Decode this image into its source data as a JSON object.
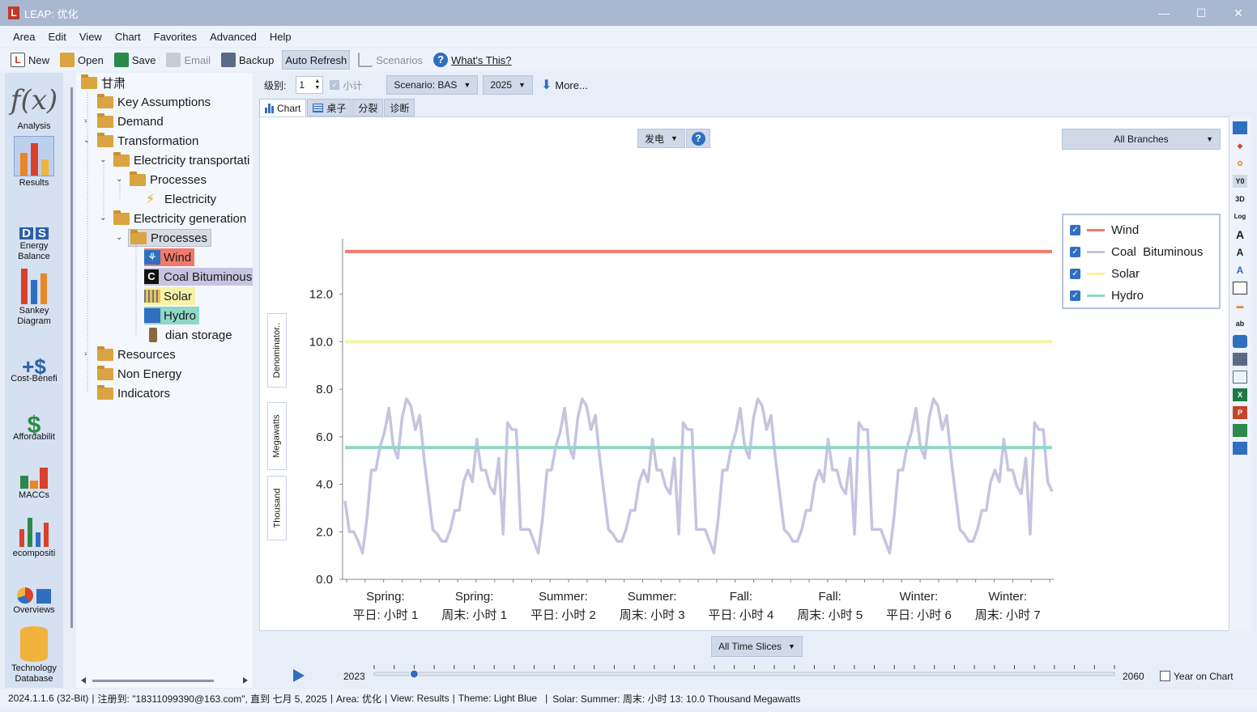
{
  "window": {
    "title": "LEAP: 优化",
    "minimize": "—",
    "maximize": "☐",
    "close": "✕"
  },
  "menu": [
    "Area",
    "Edit",
    "View",
    "Chart",
    "Favorites",
    "Advanced",
    "Help"
  ],
  "toolbar": {
    "new": "New",
    "open": "Open",
    "save": "Save",
    "email": "Email",
    "backup": "Backup",
    "auto_refresh": "Auto Refresh",
    "scenarios": "Scenarios",
    "whats_this": "What's This?"
  },
  "views": [
    {
      "label": "Analysis"
    },
    {
      "label": "Results"
    },
    {
      "label": "Energy Balance"
    },
    {
      "label": "Sankey Diagram"
    },
    {
      "label": "Cost-Benefi"
    },
    {
      "label": "Affordabilit"
    },
    {
      "label": "MACCs"
    },
    {
      "label": "ecompositi"
    },
    {
      "label": "Overviews"
    },
    {
      "label": "Technology Database"
    }
  ],
  "tree": {
    "root": "甘肃",
    "key_assumptions": "Key Assumptions",
    "demand": "Demand",
    "transformation": "Transformation",
    "elec_transport": "Electricity transportati",
    "processes1": "Processes",
    "electricity": "Electricity",
    "elec_generation": "Electricity generation",
    "processes2": "Processes",
    "wind": "Wind",
    "coal": "Coal Bituminous",
    "solar": "Solar",
    "hydro": "Hydro",
    "storage": "dian storage",
    "resources": "Resources",
    "non_energy": "Non Energy",
    "indicators": "Indicators"
  },
  "controls": {
    "level_label": "级别:",
    "level_value": "1",
    "subtotal": "小计",
    "scenario": "Scenario: BAS",
    "year": "2025",
    "more": "More...",
    "fuel": "发电",
    "help": "?",
    "branches": "All Branches",
    "time_slices": "All Time Slices"
  },
  "tabs": [
    "Chart",
    "桌子",
    "分裂",
    "诊断"
  ],
  "units": {
    "denominator": "Denominator..",
    "megawatts": "Megawatts",
    "thousand": "Thousand"
  },
  "timeline": {
    "start": "2023",
    "end": "2060",
    "year_on_chart": "Year on Chart",
    "current_position": 0.054
  },
  "status": {
    "version": "2024.1.1.6 (32-Bit)",
    "registered": "注册到: \"18311099390@163.com\", 直到 七月 5, 2025",
    "area": "Area: 优化",
    "view": "View: Results",
    "theme": "Theme: Light Blue",
    "hover": "Solar: Summer: 周末: 小时 13: 10.0 Thousand Megawatts"
  },
  "colors": {
    "wind": "#f07a6b",
    "coal": "#c7c3e0",
    "solar": "#f7f3a6",
    "hydro": "#8fd8c7",
    "accent": "#2f6fc0"
  },
  "chart_data": {
    "type": "line",
    "ylim": [
      0,
      14
    ],
    "yticks": [
      "0.0",
      "2.0",
      "4.0",
      "6.0",
      "8.0",
      "10.0",
      "12.0"
    ],
    "x_groups": [
      {
        "top": "Spring:",
        "bottom": "平日: 小时 1"
      },
      {
        "top": "Spring:",
        "bottom": "周末: 小时 1"
      },
      {
        "top": "Summer:",
        "bottom": "平日: 小时 2"
      },
      {
        "top": "Summer:",
        "bottom": "周末: 小时 3"
      },
      {
        "top": "Fall:",
        "bottom": "平日: 小时 4"
      },
      {
        "top": "Fall:",
        "bottom": "周末: 小时 5"
      },
      {
        "top": "Winter:",
        "bottom": "平日: 小时 6"
      },
      {
        "top": "Winter:",
        "bottom": "周末: 小时 7"
      }
    ],
    "series": [
      {
        "name": "Wind",
        "constant": 13.8
      },
      {
        "name": "Coal  Bituminous",
        "values": [
          3.3,
          2.0,
          2.0,
          1.6,
          1.1,
          2.6,
          4.6,
          4.6,
          5.6,
          6.2,
          7.2,
          5.6,
          5.1,
          6.8,
          7.6,
          7.3,
          6.3,
          6.9,
          5.1,
          3.6,
          2.1,
          1.9,
          1.6,
          1.6,
          2.1,
          2.9,
          2.9,
          4.1,
          4.6,
          4.1,
          5.9,
          4.6,
          4.6,
          3.9,
          3.6,
          5.1,
          1.9,
          6.6,
          6.3,
          6.3,
          2.1,
          2.1,
          2.1,
          1.6,
          1.1,
          2.6,
          4.6,
          4.6,
          5.6,
          6.2,
          7.2,
          5.6,
          5.1,
          6.8,
          7.6,
          7.3,
          6.3,
          6.9,
          5.1,
          3.6,
          2.1,
          1.9,
          1.6,
          1.6,
          2.1,
          2.9,
          2.9,
          4.1,
          4.6,
          4.1,
          5.9,
          4.6,
          4.6,
          3.9,
          3.6,
          5.1,
          1.9,
          6.6,
          6.3,
          6.3,
          2.1,
          2.1,
          2.1,
          1.6,
          1.1,
          2.6,
          4.6,
          4.6,
          5.6,
          6.2,
          7.2,
          5.6,
          5.1,
          6.8,
          7.6,
          7.3,
          6.3,
          6.9,
          5.1,
          3.6,
          2.1,
          1.9,
          1.6,
          1.6,
          2.1,
          2.9,
          2.9,
          4.1,
          4.6,
          4.1,
          5.9,
          4.6,
          4.6,
          3.9,
          3.6,
          5.1,
          1.9,
          6.6,
          6.3,
          6.3,
          2.1,
          2.1,
          2.1,
          1.6,
          1.1,
          2.6,
          4.6,
          4.6,
          5.6,
          6.2,
          7.2,
          5.6,
          5.1,
          6.8,
          7.6,
          7.3,
          6.3,
          6.9,
          5.1,
          3.6,
          2.1,
          1.9,
          1.6,
          1.6,
          2.1,
          2.9,
          2.9,
          4.1,
          4.6,
          4.1,
          5.9,
          4.6,
          4.6,
          3.9,
          3.6,
          5.1,
          1.9,
          6.6,
          6.3,
          6.3,
          4.1,
          3.7
        ]
      },
      {
        "name": "Solar",
        "constant": 10.0
      },
      {
        "name": "Hydro",
        "constant": 5.55
      }
    ],
    "legend": [
      "Wind",
      "Coal  Bituminous",
      "Solar",
      "Hydro"
    ]
  }
}
